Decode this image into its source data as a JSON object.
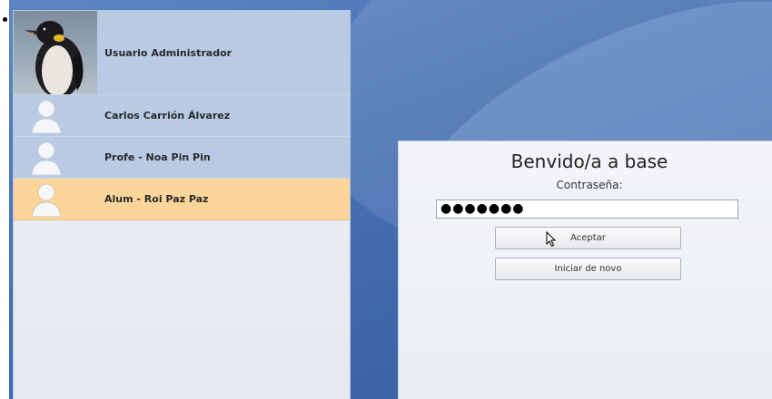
{
  "users": [
    {
      "name": "Usuario Administrador",
      "avatar": "penguin-photo",
      "selected": false
    },
    {
      "name": "Carlos Carrión Álvarez",
      "avatar": "generic-user-icon",
      "selected": false
    },
    {
      "name": "Profe - Noa Pin Pin",
      "avatar": "generic-user-icon",
      "selected": false
    },
    {
      "name": "Alum - Roi Paz Paz",
      "avatar": "generic-user-icon",
      "selected": true
    }
  ],
  "login": {
    "welcome": "Benvido/a a base",
    "password_label": "Contraseña:",
    "password_value": "●●●●●●●",
    "accept_label": "Aceptar",
    "restart_label": "Iniciar de novo"
  },
  "colors": {
    "selected_row": "#fbd59a",
    "user_row": "#b8cae4",
    "background": "#4a74b6"
  }
}
